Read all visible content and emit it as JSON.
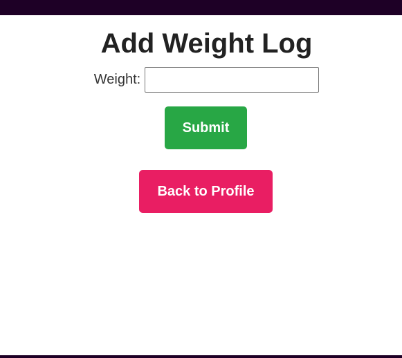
{
  "colors": {
    "top_bar": "#1e0026",
    "bottom_bar": "#1e0026",
    "submit_button": "#28a745",
    "back_button": "#e91e63"
  },
  "page": {
    "title": "Add Weight Log"
  },
  "form": {
    "weight_label": "Weight:",
    "weight_value": "",
    "submit_label": "Submit"
  },
  "navigation": {
    "back_label": "Back to Profile"
  }
}
